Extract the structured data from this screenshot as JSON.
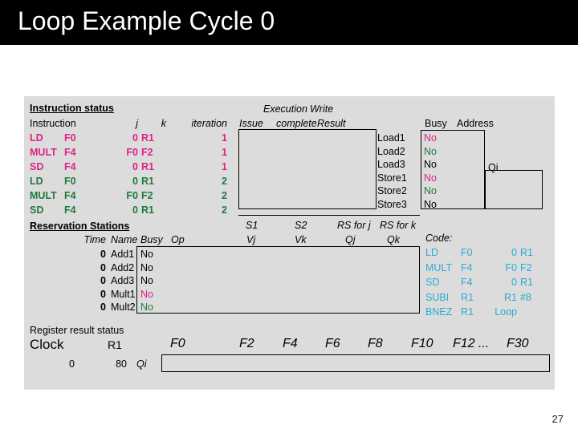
{
  "slide": {
    "title": "Loop Example Cycle 0",
    "page_number": "27",
    "colors": {
      "title_bar_bg": "#000000",
      "title_text": "#ffffff",
      "panel_bg": "#dcdcdc",
      "iteration1": "#e0218a",
      "iteration2": "#1f7a3d",
      "code": "#29abd4"
    }
  },
  "instruction_status": {
    "section_label": "Instruction status",
    "headers": {
      "instruction": "Instruction",
      "j": "j",
      "k": "k",
      "iteration": "iteration",
      "issue": "Issue",
      "execution": "Execution",
      "complete": "complete",
      "write": "Write",
      "result": "Result"
    },
    "rows": [
      {
        "op": "LD",
        "dest": "F0",
        "j": "0",
        "k": "R1",
        "iteration": "1",
        "color": "pink"
      },
      {
        "op": "MULT",
        "dest": "F4",
        "j": "F0",
        "k": "F2",
        "iteration": "1",
        "color": "pink"
      },
      {
        "op": "SD",
        "dest": "F4",
        "j": "0",
        "k": "R1",
        "iteration": "1",
        "color": "pink"
      },
      {
        "op": "LD",
        "dest": "F0",
        "j": "0",
        "k": "R1",
        "iteration": "2",
        "color": "green"
      },
      {
        "op": "MULT",
        "dest": "F4",
        "j": "F0",
        "k": "F2",
        "iteration": "2",
        "color": "green"
      },
      {
        "op": "SD",
        "dest": "F4",
        "j": "0",
        "k": "R1",
        "iteration": "2",
        "color": "green"
      }
    ]
  },
  "load_store_units": {
    "headers": {
      "busy": "Busy",
      "address": "Address",
      "qi": "Qi"
    },
    "rows": [
      {
        "name": "Load1",
        "busy": "No",
        "address": "",
        "color": "pink"
      },
      {
        "name": "Load2",
        "busy": "No",
        "address": "",
        "color": "green"
      },
      {
        "name": "Load3",
        "busy": "No",
        "address": "",
        "color": "black"
      },
      {
        "name": "Store1",
        "busy": "No",
        "address": "",
        "color": "pink"
      },
      {
        "name": "Store2",
        "busy": "No",
        "address": "",
        "color": "green"
      },
      {
        "name": "Store3",
        "busy": "No",
        "address": "",
        "color": "black"
      }
    ]
  },
  "reservation_stations": {
    "section_label": "Reservation Stations",
    "headers": {
      "time": "Time",
      "name": "Name",
      "busy": "Busy",
      "op": "Op",
      "s1": "S1",
      "vj": "Vj",
      "s2": "S2",
      "vk": "Vk",
      "rs_for_j": "RS for j",
      "qj": "Qj",
      "rs_for_k": "RS for k",
      "qk": "Qk"
    },
    "rows": [
      {
        "time": "0",
        "name": "Add1",
        "busy": "No",
        "op": "",
        "vj": "",
        "vk": "",
        "qj": "",
        "qk": "",
        "color": "black"
      },
      {
        "time": "0",
        "name": "Add2",
        "busy": "No",
        "op": "",
        "vj": "",
        "vk": "",
        "qj": "",
        "qk": "",
        "color": "black"
      },
      {
        "time": "0",
        "name": "Add3",
        "busy": "No",
        "op": "",
        "vj": "",
        "vk": "",
        "qj": "",
        "qk": "",
        "color": "black"
      },
      {
        "time": "0",
        "name": "Mult1",
        "busy": "No",
        "op": "",
        "vj": "",
        "vk": "",
        "qj": "",
        "qk": "",
        "color": "pink"
      },
      {
        "time": "0",
        "name": "Mult2",
        "busy": "No",
        "op": "",
        "vj": "",
        "vk": "",
        "qj": "",
        "qk": "",
        "color": "green"
      }
    ]
  },
  "code": {
    "label": "Code:",
    "lines": [
      {
        "op": "LD",
        "a": "F0",
        "b": "0",
        "c": "R1"
      },
      {
        "op": "MULT",
        "a": "F4",
        "b": "F0",
        "c": "F2"
      },
      {
        "op": "SD",
        "a": "F4",
        "b": "0",
        "c": "R1"
      },
      {
        "op": "SUBI",
        "a": "R1",
        "b": "R1",
        "c": "#8"
      },
      {
        "op": "BNEZ",
        "a": "R1",
        "b": "Loop",
        "c": ""
      }
    ]
  },
  "register_result_status": {
    "section_label": "Register result status",
    "clock_label": "Clock",
    "clock_value": "0",
    "r1_label": "R1",
    "r1_value": "80",
    "qi_label": "Qi",
    "registers": [
      "F0",
      "F2",
      "F4",
      "F6",
      "F8",
      "F10",
      "F12 ...",
      "F30"
    ],
    "values": [
      "",
      "",
      "",
      "",
      "",
      "",
      "",
      ""
    ]
  }
}
